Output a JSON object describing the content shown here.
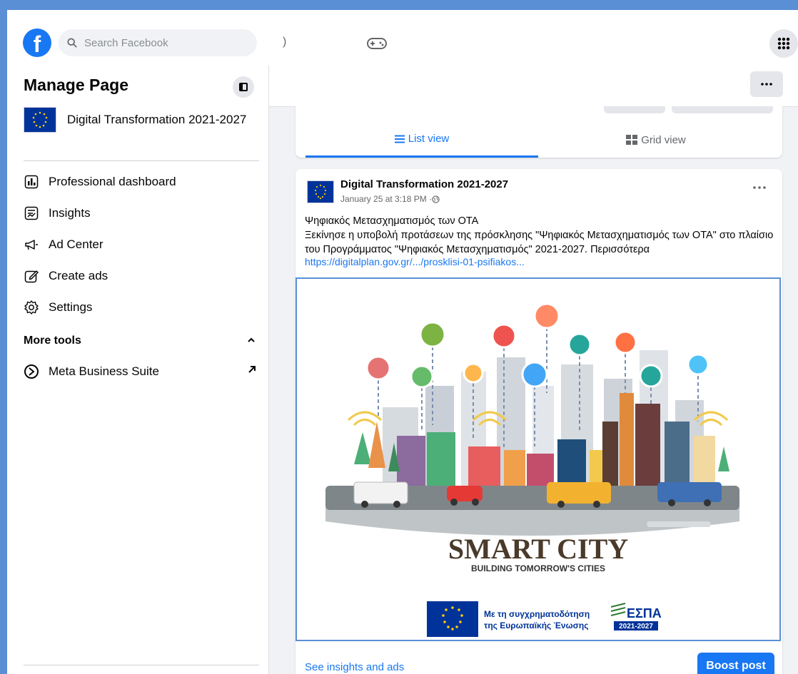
{
  "topbar": {
    "logo_letter": "f",
    "search_placeholder": "Search Facebook",
    "paren_glyph": ")"
  },
  "sidebar": {
    "title": "Manage Page",
    "page_name": "Digital Transformation 2021-2027",
    "items": [
      {
        "label": "Professional dashboard",
        "icon": "dashboard-icon"
      },
      {
        "label": "Insights",
        "icon": "insights-icon"
      },
      {
        "label": "Ad Center",
        "icon": "megaphone-icon"
      },
      {
        "label": "Create ads",
        "icon": "pencil-icon"
      },
      {
        "label": "Settings",
        "icon": "gear-icon"
      }
    ],
    "more_tools_label": "More tools",
    "meta_business_label": "Meta Business Suite"
  },
  "tabs": {
    "list_view": "List view",
    "grid_view": "Grid view"
  },
  "post": {
    "author": "Digital Transformation 2021-2027",
    "timestamp": "January 25 at 3:18 PM · ",
    "line1": "Ψηφιακός Μετασχηματισμός των ΟΤΑ",
    "line2": "Ξεκίνησε η υποβολή προτάσεων της πρόσκλησης \"Ψηφιακός Μετασχηματισμός των ΟΤΑ\" στο πλαίσιο του Προγράμματος \"Ψηφιακός Μετασχηματισμός\" 2021-2027. Περισσότερα",
    "link": "https://digitalplan.gov.gr/.../prosklisi-01-psifiakos...",
    "image": {
      "headline": "SMART CITY",
      "tagline": "BUILDING TOMORROW'S CITIES",
      "cofund_line1": "Με τη συγχρηματοδότηση",
      "cofund_line2": "της Ευρωπαϊκής Ένωσης",
      "espa_title": "ΕΣΠΑ",
      "espa_years": "2021-2027"
    },
    "insights_link": "See insights and ads",
    "boost_label": "Boost post"
  },
  "colors": {
    "accent": "#1877f2",
    "frame": "#5a8fd6",
    "eu_blue": "#003399"
  }
}
